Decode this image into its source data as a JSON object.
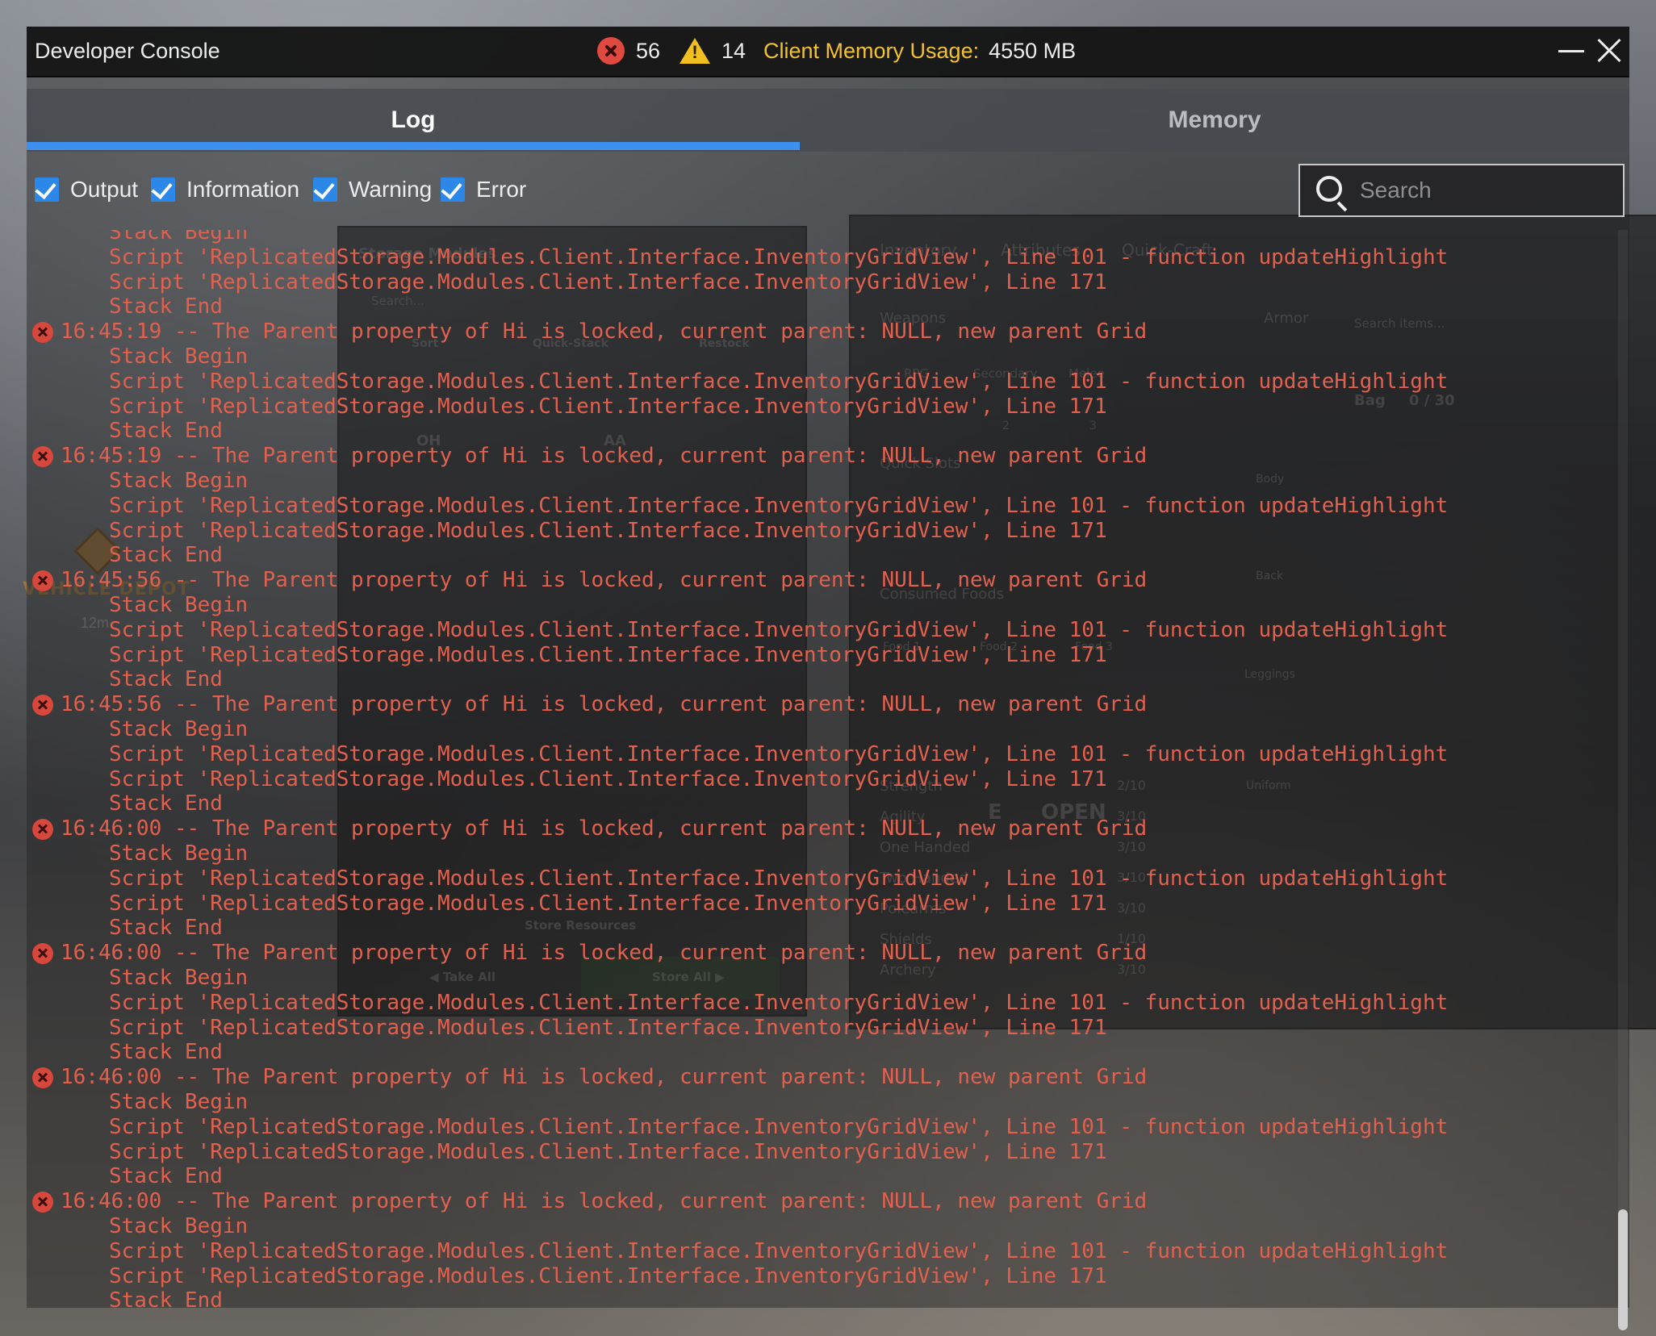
{
  "window": {
    "title": "Developer Console",
    "error_count": "56",
    "warning_count": "14",
    "memory_label": "Client Memory Usage:",
    "memory_value": "4550 MB"
  },
  "tabs": [
    {
      "label": "Log",
      "active": true
    },
    {
      "label": "Memory",
      "active": false
    }
  ],
  "filters": [
    {
      "label": "Output",
      "checked": true
    },
    {
      "label": "Information",
      "checked": true
    },
    {
      "label": "Warning",
      "checked": true
    },
    {
      "label": "Error",
      "checked": true
    }
  ],
  "search": {
    "placeholder": "Search",
    "value": ""
  },
  "colors": {
    "accent": "#3d8ff0",
    "error": "#e2604e",
    "warning": "#f2bf20",
    "memory_label": "#f2c230"
  },
  "icons": {
    "error_count": "error-icon",
    "warning_count": "warning-icon",
    "minimize": "minimize-icon",
    "close": "close-icon",
    "search": "search-icon",
    "log_error": "error-icon"
  },
  "log": {
    "lines": [
      {
        "kind": "stack",
        "text": "Stack Begin"
      },
      {
        "kind": "stack",
        "text": "Script 'ReplicatedStorage.Modules.Client.Interface.InventoryGridView', Line 101 - function updateHighlight"
      },
      {
        "kind": "stack",
        "text": "Script 'ReplicatedStorage.Modules.Client.Interface.InventoryGridView', Line 171"
      },
      {
        "kind": "stack",
        "text": "Stack End"
      },
      {
        "kind": "head",
        "text": "16:45:19 -- The Parent property of Hi is locked, current parent: NULL, new parent Grid"
      },
      {
        "kind": "stack",
        "text": "Stack Begin"
      },
      {
        "kind": "stack",
        "text": "Script 'ReplicatedStorage.Modules.Client.Interface.InventoryGridView', Line 101 - function updateHighlight"
      },
      {
        "kind": "stack",
        "text": "Script 'ReplicatedStorage.Modules.Client.Interface.InventoryGridView', Line 171"
      },
      {
        "kind": "stack",
        "text": "Stack End"
      },
      {
        "kind": "head",
        "text": "16:45:19 -- The Parent property of Hi is locked, current parent: NULL, new parent Grid"
      },
      {
        "kind": "stack",
        "text": "Stack Begin"
      },
      {
        "kind": "stack",
        "text": "Script 'ReplicatedStorage.Modules.Client.Interface.InventoryGridView', Line 101 - function updateHighlight"
      },
      {
        "kind": "stack",
        "text": "Script 'ReplicatedStorage.Modules.Client.Interface.InventoryGridView', Line 171"
      },
      {
        "kind": "stack",
        "text": "Stack End"
      },
      {
        "kind": "head",
        "text": "16:45:56 -- The Parent property of Hi is locked, current parent: NULL, new parent Grid"
      },
      {
        "kind": "stack",
        "text": "Stack Begin"
      },
      {
        "kind": "stack",
        "text": "Script 'ReplicatedStorage.Modules.Client.Interface.InventoryGridView', Line 101 - function updateHighlight"
      },
      {
        "kind": "stack",
        "text": "Script 'ReplicatedStorage.Modules.Client.Interface.InventoryGridView', Line 171"
      },
      {
        "kind": "stack",
        "text": "Stack End"
      },
      {
        "kind": "head",
        "text": "16:45:56 -- The Parent property of Hi is locked, current parent: NULL, new parent Grid"
      },
      {
        "kind": "stack",
        "text": "Stack Begin"
      },
      {
        "kind": "stack",
        "text": "Script 'ReplicatedStorage.Modules.Client.Interface.InventoryGridView', Line 101 - function updateHighlight"
      },
      {
        "kind": "stack",
        "text": "Script 'ReplicatedStorage.Modules.Client.Interface.InventoryGridView', Line 171"
      },
      {
        "kind": "stack",
        "text": "Stack End"
      },
      {
        "kind": "head",
        "text": "16:46:00 -- The Parent property of Hi is locked, current parent: NULL, new parent Grid"
      },
      {
        "kind": "stack",
        "text": "Stack Begin"
      },
      {
        "kind": "stack",
        "text": "Script 'ReplicatedStorage.Modules.Client.Interface.InventoryGridView', Line 101 - function updateHighlight"
      },
      {
        "kind": "stack",
        "text": "Script 'ReplicatedStorage.Modules.Client.Interface.InventoryGridView', Line 171"
      },
      {
        "kind": "stack",
        "text": "Stack End"
      },
      {
        "kind": "head",
        "text": "16:46:00 -- The Parent property of Hi is locked, current parent: NULL, new parent Grid"
      },
      {
        "kind": "stack",
        "text": "Stack Begin"
      },
      {
        "kind": "stack",
        "text": "Script 'ReplicatedStorage.Modules.Client.Interface.InventoryGridView', Line 101 - function updateHighlight"
      },
      {
        "kind": "stack",
        "text": "Script 'ReplicatedStorage.Modules.Client.Interface.InventoryGridView', Line 171"
      },
      {
        "kind": "stack",
        "text": "Stack End"
      },
      {
        "kind": "head",
        "text": "16:46:00 -- The Parent property of Hi is locked, current parent: NULL, new parent Grid"
      },
      {
        "kind": "stack",
        "text": "Stack Begin"
      },
      {
        "kind": "stack",
        "text": "Script 'ReplicatedStorage.Modules.Client.Interface.InventoryGridView', Line 101 - function updateHighlight"
      },
      {
        "kind": "stack",
        "text": "Script 'ReplicatedStorage.Modules.Client.Interface.InventoryGridView', Line 171"
      },
      {
        "kind": "stack",
        "text": "Stack End"
      },
      {
        "kind": "head",
        "text": "16:46:00 -- The Parent property of Hi is locked, current parent: NULL, new parent Grid"
      },
      {
        "kind": "stack",
        "text": "Stack Begin"
      },
      {
        "kind": "stack",
        "text": "Script 'ReplicatedStorage.Modules.Client.Interface.InventoryGridView', Line 101 - function updateHighlight"
      },
      {
        "kind": "stack",
        "text": "Script 'ReplicatedStorage.Modules.Client.Interface.InventoryGridView', Line 171"
      },
      {
        "kind": "stack",
        "text": "Stack End"
      }
    ]
  },
  "background_game": {
    "marker_label": "VEHICLE DEPOT",
    "marker_distance": "12m",
    "storage_panel": {
      "title": "Storage Modules",
      "search_placeholder": "Search...",
      "buttons": [
        "Sort",
        "Quick-Stack",
        "Restock"
      ],
      "slots": [
        "OH",
        "AA"
      ],
      "store_resources": "Store Resources",
      "take_all": "◀ Take All",
      "store_all": "Store All ▶"
    },
    "inventory_panel": {
      "tabs": [
        "Inventory",
        "Attributes",
        "Quick-Craft"
      ],
      "search_placeholder": "Search items...",
      "weapons_label": "Weapons",
      "armor_label": "Armor",
      "weapon_slots": [
        "RPG",
        "Secondary",
        "Melee"
      ],
      "slot_numbers": [
        "2",
        "3"
      ],
      "quick_slots_label": "Quick Slots",
      "consumed_foods_label": "Consumed Foods",
      "food_slots": [
        "Food 1",
        "Food 2",
        "Food 3"
      ],
      "armor_slots": [
        "Body",
        "Back",
        "Leggings",
        "Uniform"
      ],
      "bag_label": "Bag",
      "bag_count": "0 / 30",
      "attributes": [
        {
          "name": "Strength",
          "value": "2/10"
        },
        {
          "name": "Agility",
          "value": "3/10"
        },
        {
          "name": "One Handed",
          "value": "3/10"
        },
        {
          "name": "Two Handed",
          "value": "3/10"
        },
        {
          "name": "Polearms",
          "value": "3/10"
        },
        {
          "name": "Shields",
          "value": "1/10"
        },
        {
          "name": "Archery",
          "value": "3/10"
        }
      ],
      "prompt_key": "E",
      "prompt_text": "OPEN"
    }
  }
}
